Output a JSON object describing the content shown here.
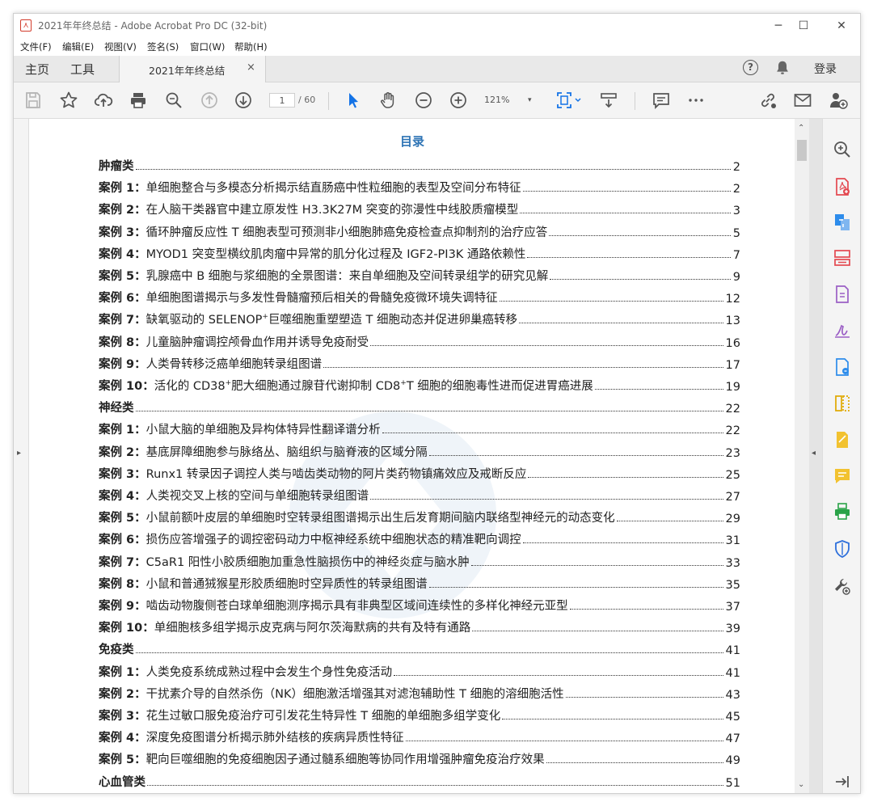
{
  "window": {
    "title": "2021年年终总结 - Adobe Acrobat Pro DC (32-bit)",
    "app_icon": "pdf-icon",
    "minimize": "─",
    "maximize": "☐",
    "close": "✕"
  },
  "menu": [
    "文件(F)",
    "编辑(E)",
    "视图(V)",
    "签名(S)",
    "窗口(W)",
    "帮助(H)"
  ],
  "tabs": {
    "home": "主页",
    "tools": "工具",
    "document": "2021年年终总结",
    "close": "×",
    "help": "?",
    "login": "登录"
  },
  "toolbar": {
    "page_current": "1",
    "page_total": "/ 60",
    "zoom": "121%",
    "zoom_caret": "▾"
  },
  "nav": {
    "left_arrow": "▸",
    "right_arrow": "◂",
    "scroll_up": "⌃",
    "scroll_down": "⌄"
  },
  "toc": {
    "title": "目录",
    "rows": [
      {
        "type": "cat",
        "title": "肿瘤类",
        "page": "2"
      },
      {
        "type": "case",
        "num": "案例 1：",
        "title": "单细胞整合与多模态分析揭示结直肠癌中性粒细胞的表型及空间分布特征",
        "page": "2"
      },
      {
        "type": "case",
        "num": "案例 2：",
        "title": "在人脑干类器官中建立原发性 H3.3K27M 突变的弥漫性中线胶质瘤模型",
        "page": "3"
      },
      {
        "type": "case",
        "num": "案例 3：",
        "title": "循环肿瘤反应性 T 细胞表型可预测非小细胞肺癌免疫检查点抑制剂的治疗应答",
        "page": "5"
      },
      {
        "type": "case",
        "num": "案例 4：",
        "title": "MYOD1 突变型横纹肌肉瘤中异常的肌分化过程及 IGF2-PI3K 通路依赖性",
        "page": "7"
      },
      {
        "type": "case",
        "num": "案例 5：",
        "title": "乳腺癌中 B 细胞与浆细胞的全景图谱：来自单细胞及空间转录组学的研究见解",
        "page": "9"
      },
      {
        "type": "case",
        "num": "案例 6：",
        "title": "单细胞图谱揭示与多发性骨髓瘤预后相关的骨髓免疫微环境失调特征",
        "page": "12"
      },
      {
        "type": "case",
        "num": "案例 7：",
        "title": "缺氧驱动的 SELENOP",
        "sup": "+",
        "title2": "巨噬细胞重塑塑造 T 细胞动态并促进卵巢癌转移",
        "page": "13"
      },
      {
        "type": "case",
        "num": "案例 8：",
        "title": "儿童脑肿瘤调控颅骨血作用并诱导免疫耐受",
        "page": "16"
      },
      {
        "type": "case",
        "num": "案例 9：",
        "title": "人类骨转移泛癌单细胞转录组图谱",
        "page": "17"
      },
      {
        "type": "case",
        "num": "案例 10：",
        "title": "活化的 CD38",
        "sup": "+",
        "title2": "肥大细胞通过腺苷代谢抑制 CD8",
        "sup2": "+",
        "title3": "T 细胞的细胞毒性进而促进胃癌进展",
        "page": "19"
      },
      {
        "type": "cat",
        "title": "神经类",
        "page": "22"
      },
      {
        "type": "case",
        "num": "案例 1：",
        "title": "小鼠大脑的单细胞及异构体特异性翻译谱分析",
        "page": "22"
      },
      {
        "type": "case",
        "num": "案例 2：",
        "title": "基底屏障细胞参与脉络丛、脑组织与脑脊液的区域分隔",
        "page": "23"
      },
      {
        "type": "case",
        "num": "案例 3：",
        "title": "Runx1 转录因子调控人类与啮齿类动物的阿片类药物镇痛效应及戒断反应",
        "page": "25"
      },
      {
        "type": "case",
        "num": "案例 4：",
        "title": "人类视交叉上核的空间与单细胞转录组图谱",
        "page": "27"
      },
      {
        "type": "case",
        "num": "案例 5：",
        "title": "小鼠前额叶皮层的单细胞时空转录组图谱揭示出生后发育期间脑内联络型神经元的动态变化",
        "page": "29"
      },
      {
        "type": "case",
        "num": "案例 6：",
        "title": "损伤应答增强子的调控密码动力中枢神经系统中细胞状态的精准靶向调控",
        "page": "31"
      },
      {
        "type": "case",
        "num": "案例 7：",
        "title": "C5aR1 阳性小胶质细胞加重急性脑损伤中的神经炎症与脑水肿",
        "page": "33"
      },
      {
        "type": "case",
        "num": "案例 8：",
        "title": "小鼠和普通狨猴星形胶质细胞时空异质性的转录组图谱",
        "page": "35"
      },
      {
        "type": "case",
        "num": "案例 9：",
        "title": "啮齿动物腹侧苍白球单细胞测序揭示具有非典型区域间连续性的多样化神经元亚型",
        "page": "37"
      },
      {
        "type": "case",
        "num": "案例 10：",
        "title": "单细胞核多组学揭示皮克病与阿尔茨海默病的共有及特有通路",
        "page": "39"
      },
      {
        "type": "cat",
        "title": "免疫类",
        "page": "41"
      },
      {
        "type": "case",
        "num": "案例 1：",
        "title": "人类免疫系统成熟过程中会发生个身性免疫活动",
        "page": "41"
      },
      {
        "type": "case",
        "num": "案例 2：",
        "title": "干扰素介导的自然杀伤（NK）细胞激活增强其对滤泡辅助性 T 细胞的溶细胞活性",
        "page": "43"
      },
      {
        "type": "case",
        "num": "案例 3：",
        "title": "花生过敏口服免疫治疗可引发花生特异性 T 细胞的单细胞多组学变化",
        "page": "45"
      },
      {
        "type": "case",
        "num": "案例 4：",
        "title": "深度免疫图谱分析揭示肺外结核的疾病异质性特征",
        "page": "47"
      },
      {
        "type": "case",
        "num": "案例 5：",
        "title": "靶向巨噬细胞的免疫细胞因子通过髓系细胞等协同作用增强肿瘤免疫治疗效果",
        "page": "49"
      },
      {
        "type": "cat",
        "title": "心血管类",
        "page": "51"
      }
    ]
  }
}
